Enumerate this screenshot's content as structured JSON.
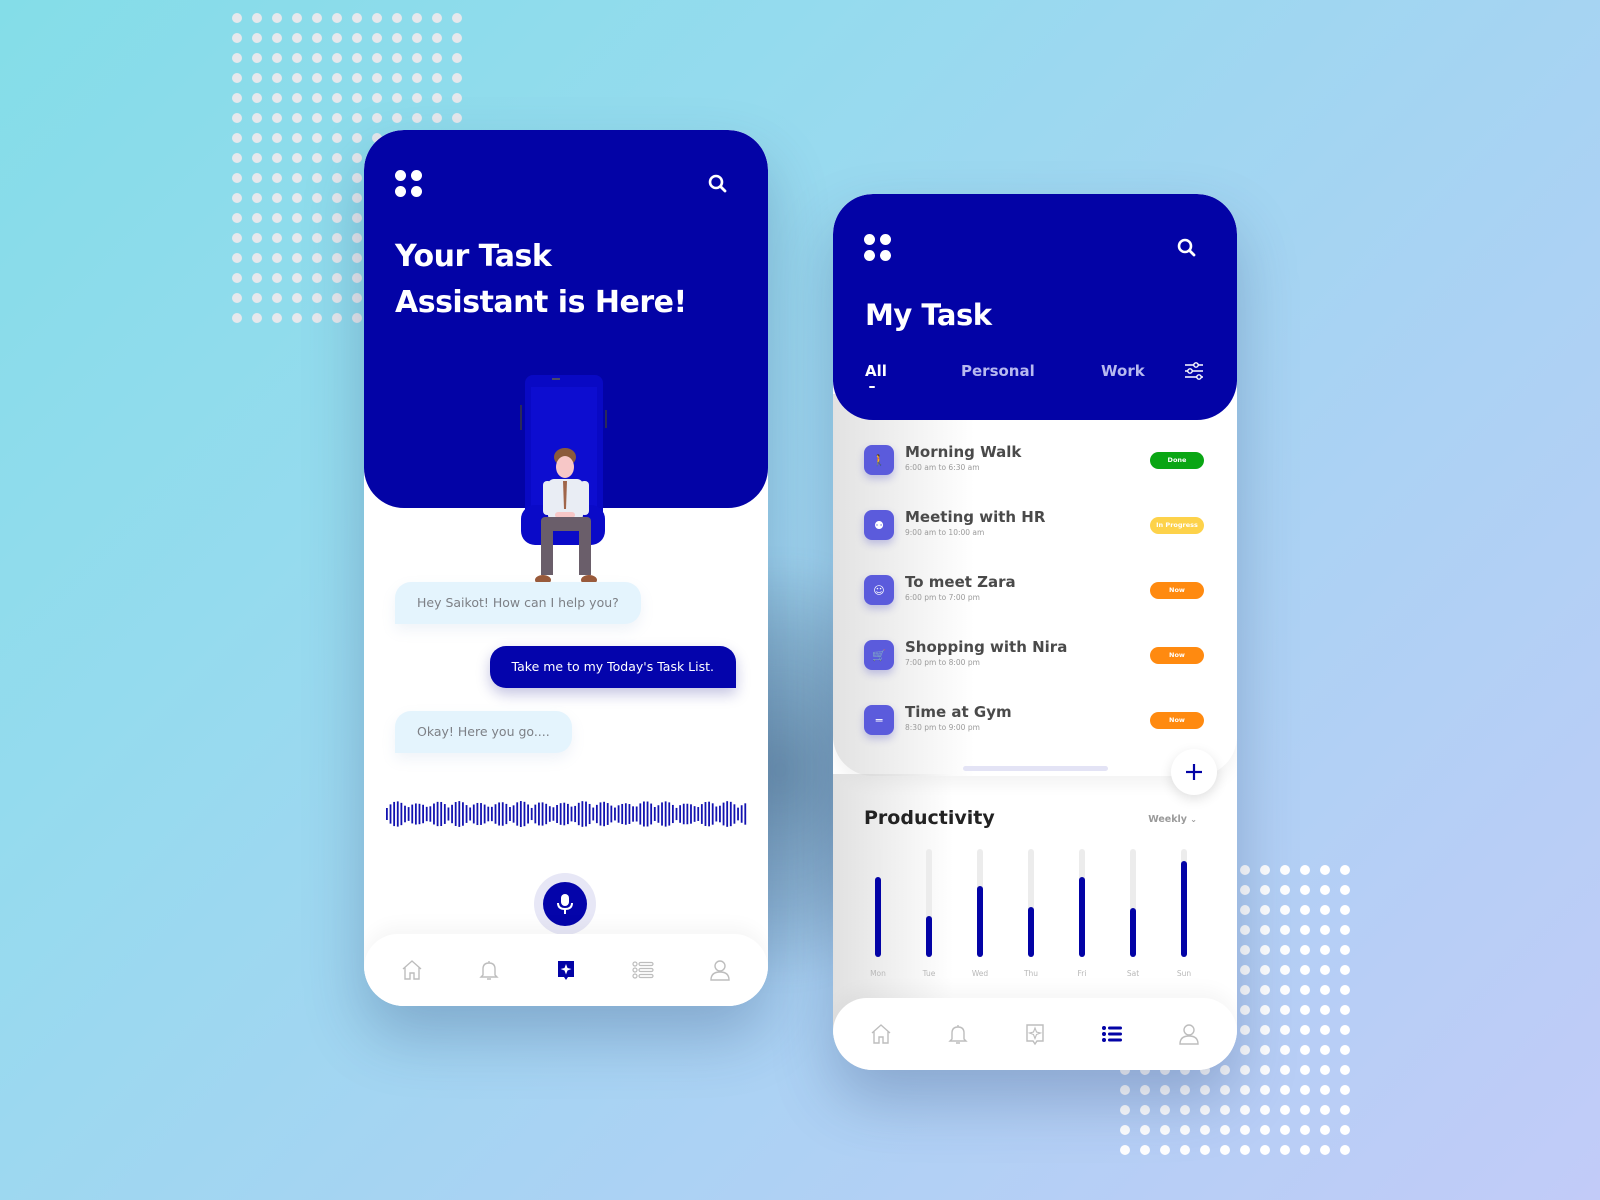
{
  "background": {
    "gradient_start": "#84dde8",
    "gradient_end": "#c2cbf8"
  },
  "colors": {
    "brand": "#0303a6",
    "task_icon": "#5b5bdc",
    "done": "#0aa614",
    "in_progress": "#fdd24a",
    "now": "#ff8a10"
  },
  "assistant_screen": {
    "menu_icon": "menu-dots-icon",
    "search_icon": "search-icon",
    "title": "Your Task\nAssistant is Here!",
    "messages": [
      {
        "from": "bot",
        "text": "Hey Saikot! How can I help you?"
      },
      {
        "from": "user",
        "text": "Take me to my Today's Task List."
      },
      {
        "from": "bot",
        "text": "Okay! Here you go...."
      }
    ],
    "mic_icon": "microphone-icon",
    "nav": [
      {
        "icon": "home-icon",
        "active": false
      },
      {
        "icon": "bell-icon",
        "active": false
      },
      {
        "icon": "assistant-icon",
        "active": true
      },
      {
        "icon": "list-icon",
        "active": false
      },
      {
        "icon": "user-icon",
        "active": false
      }
    ]
  },
  "task_screen": {
    "title": "My Task",
    "tabs": [
      {
        "label": "All",
        "active": true
      },
      {
        "label": "Personal",
        "active": false
      },
      {
        "label": "Work",
        "active": false
      }
    ],
    "filter_icon": "sliders-icon",
    "tasks": [
      {
        "title": "Morning Walk",
        "time": "6:00 am to 6:30 am",
        "status": "Done",
        "icon": "walking-icon"
      },
      {
        "title": "Meeting with HR",
        "time": "9:00 am to 10:00 am",
        "status": "In Progress",
        "icon": "meeting-icon"
      },
      {
        "title": "To meet Zara",
        "time": "6:00 pm to 7:00 pm",
        "status": "Now",
        "icon": "people-icon"
      },
      {
        "title": "Shopping with Nira",
        "time": "7:00 pm to 8:00 pm",
        "status": "Now",
        "icon": "cart-icon"
      },
      {
        "title": "Time at Gym",
        "time": "8:30 pm to 9:00 pm",
        "status": "Now",
        "icon": "dumbbell-icon"
      }
    ],
    "add_button_icon": "plus-icon",
    "productivity": {
      "title": "Productivity",
      "period": "Weekly"
    },
    "nav": [
      {
        "icon": "home-icon",
        "active": false
      },
      {
        "icon": "bell-icon",
        "active": false
      },
      {
        "icon": "assistant-icon",
        "active": false
      },
      {
        "icon": "list-icon",
        "active": true
      },
      {
        "icon": "user-icon",
        "active": false
      }
    ]
  },
  "chart_data": {
    "type": "bar",
    "title": "Productivity",
    "categories": [
      "Mon",
      "Tue",
      "Wed",
      "Thu",
      "Fri",
      "Sat",
      "Sun"
    ],
    "values": [
      0.74,
      0.38,
      0.66,
      0.46,
      0.74,
      0.45,
      0.89
    ],
    "ylim": [
      0,
      1
    ],
    "xlabel": "",
    "ylabel": "",
    "grid": false,
    "legend": "none"
  }
}
